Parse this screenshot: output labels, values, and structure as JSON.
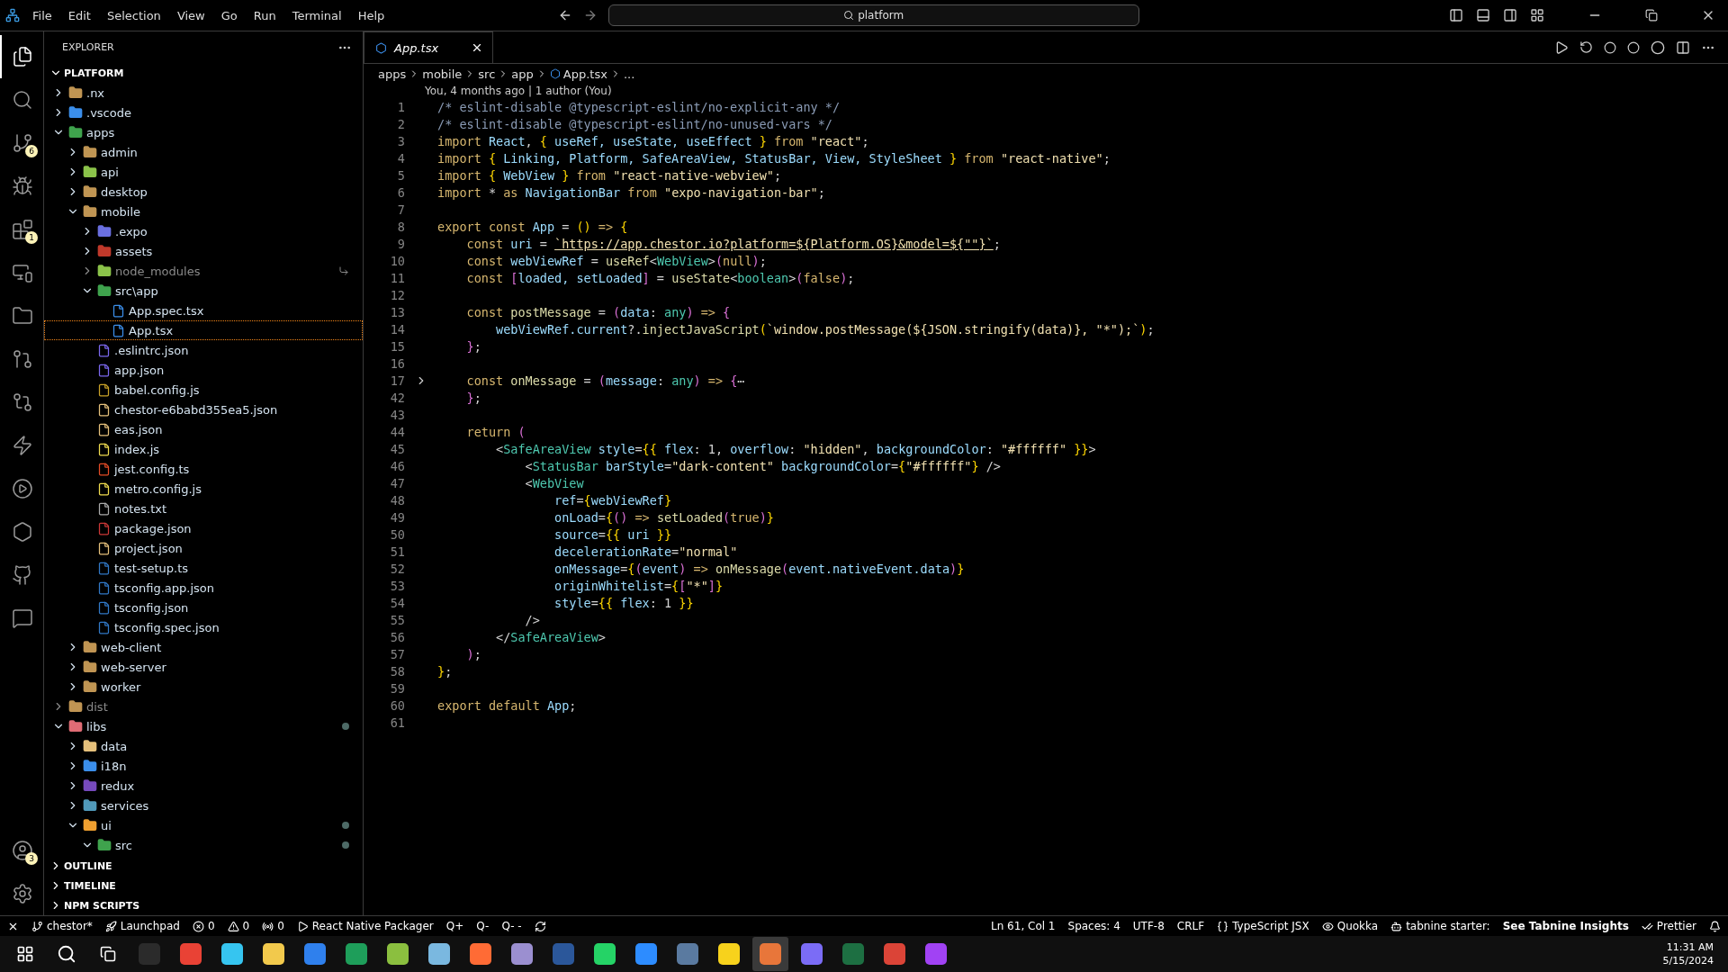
{
  "menu": [
    "File",
    "Edit",
    "Selection",
    "View",
    "Go",
    "Run",
    "Terminal",
    "Help"
  ],
  "command_center": {
    "value": "platform"
  },
  "activity_bar": [
    {
      "selected": true
    },
    {
      "selected": false
    },
    {
      "selected": false,
      "badge": "6"
    },
    {
      "selected": false
    },
    {
      "selected": false,
      "badge": "1"
    },
    {
      "selected": false
    },
    {
      "selected": false
    },
    {
      "selected": false
    },
    {
      "selected": false
    },
    {
      "selected": false
    },
    {
      "selected": false
    },
    {
      "selected": false
    },
    {
      "selected": false
    },
    {
      "selected": false
    }
  ],
  "account": {
    "badge": "3"
  },
  "explorer": {
    "title": "EXPLORER",
    "root": "PLATFORM",
    "root_expanded": true,
    "tree": [
      {
        "name": ".nx",
        "kind": "folder",
        "expanded": false,
        "color": "#c09553"
      },
      {
        "name": ".vscode",
        "kind": "folder",
        "expanded": false,
        "color": "#3b8eea"
      },
      {
        "name": "apps",
        "kind": "folder",
        "expanded": true,
        "color": "#3fa34d",
        "children": [
          {
            "name": "admin",
            "kind": "folder",
            "expanded": false,
            "color": "#c09553"
          },
          {
            "name": "api",
            "kind": "folder",
            "expanded": false,
            "color": "#8bc34a"
          },
          {
            "name": "desktop",
            "kind": "folder",
            "expanded": false,
            "color": "#c09553"
          },
          {
            "name": "mobile",
            "kind": "folder",
            "expanded": true,
            "color": "#c09553",
            "children": [
              {
                "name": ".expo",
                "kind": "folder",
                "expanded": false,
                "color": "#6a6fe0"
              },
              {
                "name": "assets",
                "kind": "folder",
                "expanded": false,
                "color": "#c0392b"
              },
              {
                "name": "node_modules",
                "kind": "folder",
                "expanded": false,
                "color": "#8bc34a",
                "ignored": true,
                "linked": true
              },
              {
                "name": "src\\app",
                "kind": "folder",
                "expanded": true,
                "color": "#3fa34d",
                "children": [
                  {
                    "name": "App.spec.tsx",
                    "kind": "file",
                    "color": "#3b8eea",
                    "selected": false
                  },
                  {
                    "name": "App.tsx",
                    "kind": "file",
                    "color": "#3b8eea",
                    "selected": true
                  }
                ]
              },
              {
                "name": ".eslintrc.json",
                "kind": "file",
                "color": "#7b68ee"
              },
              {
                "name": "app.json",
                "kind": "file",
                "color": "#7b68ee"
              },
              {
                "name": "babel.config.js",
                "kind": "file",
                "color": "#c9a227"
              },
              {
                "name": "chestor-e6babd355ea5.json",
                "kind": "file",
                "color": "#e5c07b"
              },
              {
                "name": "eas.json",
                "kind": "file",
                "color": "#e5c07b"
              },
              {
                "name": "index.js",
                "kind": "file",
                "color": "#f0db4f"
              },
              {
                "name": "jest.config.ts",
                "kind": "file",
                "color": "#e34c26"
              },
              {
                "name": "metro.config.js",
                "kind": "file",
                "color": "#f0db4f"
              },
              {
                "name": "notes.txt",
                "kind": "file",
                "color": "#aaaaaa"
              },
              {
                "name": "package.json",
                "kind": "file",
                "color": "#cb3837"
              },
              {
                "name": "project.json",
                "kind": "file",
                "color": "#e5c07b"
              },
              {
                "name": "test-setup.ts",
                "kind": "file",
                "color": "#3178c6"
              },
              {
                "name": "tsconfig.app.json",
                "kind": "file",
                "color": "#3178c6"
              },
              {
                "name": "tsconfig.json",
                "kind": "file",
                "color": "#3178c6"
              },
              {
                "name": "tsconfig.spec.json",
                "kind": "file",
                "color": "#3178c6"
              }
            ]
          },
          {
            "name": "web-client",
            "kind": "folder",
            "expanded": false,
            "color": "#c09553"
          },
          {
            "name": "web-server",
            "kind": "folder",
            "expanded": false,
            "color": "#c09553"
          },
          {
            "name": "worker",
            "kind": "folder",
            "expanded": false,
            "color": "#c09553"
          }
        ]
      },
      {
        "name": "dist",
        "kind": "folder",
        "expanded": false,
        "color": "#c09553",
        "ignored": true
      },
      {
        "name": "libs",
        "kind": "folder",
        "expanded": true,
        "color": "#e06c75",
        "modified": true,
        "children": [
          {
            "name": "data",
            "kind": "folder",
            "expanded": false,
            "color": "#e5c07b"
          },
          {
            "name": "i18n",
            "kind": "folder",
            "expanded": false,
            "color": "#3b8eea"
          },
          {
            "name": "redux",
            "kind": "folder",
            "expanded": false,
            "color": "#764abc"
          },
          {
            "name": "services",
            "kind": "folder",
            "expanded": false,
            "color": "#519aba"
          },
          {
            "name": "ui",
            "kind": "folder",
            "expanded": true,
            "color": "#f0a030",
            "modified": true,
            "children": [
              {
                "name": "src",
                "kind": "folder",
                "expanded": true,
                "color": "#3fa34d",
                "modified": true
              }
            ]
          }
        ]
      }
    ],
    "sections": [
      {
        "label": "OUTLINE",
        "expanded": false
      },
      {
        "label": "TIMELINE",
        "expanded": false
      },
      {
        "label": "NPM SCRIPTS",
        "expanded": false
      }
    ]
  },
  "tabs": [
    {
      "label": "App.tsx",
      "selected": true
    }
  ],
  "breadcrumbs": [
    "apps",
    "mobile",
    "src",
    "app",
    "App.tsx",
    "..."
  ],
  "blame": "You, 4 months ago | 1 author (You)",
  "code": [
    {
      "number": "1",
      "segments": [
        {
          "kind": "comment",
          "text": "/* eslint-disable @typescript-eslint/no-explicit-any */"
        }
      ]
    },
    {
      "number": "2",
      "segments": [
        {
          "kind": "comment",
          "text": "/* eslint-disable @typescript-eslint/no-unused-vars */"
        }
      ]
    },
    {
      "number": "3",
      "segments": [
        {
          "kind": "keyword",
          "text": "import "
        },
        {
          "kind": "ident",
          "text": "React"
        },
        {
          "kind": "punct",
          "text": ", "
        },
        {
          "kind": "brace",
          "text": "{"
        },
        {
          "kind": "ident",
          "text": " useRef, useState, useEffect "
        },
        {
          "kind": "brace",
          "text": "}"
        },
        {
          "kind": "keyword",
          "text": " from "
        },
        {
          "kind": "string",
          "text": "\"react\""
        },
        {
          "kind": "punct",
          "text": ";"
        }
      ]
    },
    {
      "number": "4",
      "segments": [
        {
          "kind": "keyword",
          "text": "import "
        },
        {
          "kind": "brace",
          "text": "{"
        },
        {
          "kind": "ident",
          "text": " Linking, Platform, SafeAreaView, StatusBar, View, StyleSheet "
        },
        {
          "kind": "brace",
          "text": "}"
        },
        {
          "kind": "keyword",
          "text": " from "
        },
        {
          "kind": "string",
          "text": "\"react-native\""
        },
        {
          "kind": "punct",
          "text": ";"
        }
      ]
    },
    {
      "number": "5",
      "segments": [
        {
          "kind": "keyword",
          "text": "import "
        },
        {
          "kind": "brace",
          "text": "{"
        },
        {
          "kind": "ident",
          "text": " WebView "
        },
        {
          "kind": "brace",
          "text": "}"
        },
        {
          "kind": "keyword",
          "text": " from "
        },
        {
          "kind": "string",
          "text": "\"react-native-webview\""
        },
        {
          "kind": "punct",
          "text": ";"
        }
      ]
    },
    {
      "number": "6",
      "segments": [
        {
          "kind": "keyword",
          "text": "import "
        },
        {
          "kind": "punct",
          "text": "* "
        },
        {
          "kind": "keyword",
          "text": "as "
        },
        {
          "kind": "ident",
          "text": "NavigationBar "
        },
        {
          "kind": "keyword",
          "text": "from "
        },
        {
          "kind": "string",
          "text": "\"expo-navigation-bar\""
        },
        {
          "kind": "punct",
          "text": ";"
        }
      ]
    },
    {
      "number": "7"
    },
    {
      "number": "8",
      "segments": [
        {
          "kind": "keyword",
          "text": "export const "
        },
        {
          "kind": "ident",
          "text": "App"
        },
        {
          "kind": "punct",
          "text": " = "
        },
        {
          "kind": "brace",
          "text": "()"
        },
        {
          "kind": "keyword",
          "text": " => "
        },
        {
          "kind": "brace",
          "text": "{"
        }
      ]
    },
    {
      "number": "9",
      "segments": [
        {
          "kind": "keyword",
          "text": "    const "
        },
        {
          "kind": "ident",
          "text": "uri"
        },
        {
          "kind": "punct",
          "text": " = "
        },
        {
          "kind": "url",
          "text": "`https://app.chestor.io?platform=${Platform.OS}&model=${\"\"}`"
        },
        {
          "kind": "punct",
          "text": ";"
        }
      ]
    },
    {
      "number": "10",
      "segments": [
        {
          "kind": "keyword",
          "text": "    const "
        },
        {
          "kind": "ident",
          "text": "webViewRef"
        },
        {
          "kind": "punct",
          "text": " = "
        },
        {
          "kind": "function",
          "text": "useRef"
        },
        {
          "kind": "punct",
          "text": "<"
        },
        {
          "kind": "type",
          "text": "WebView"
        },
        {
          "kind": "punct",
          "text": ">"
        },
        {
          "kind": "paren",
          "text": "("
        },
        {
          "kind": "keyword",
          "text": "null"
        },
        {
          "kind": "paren",
          "text": ")"
        },
        {
          "kind": "punct",
          "text": ";"
        }
      ]
    },
    {
      "number": "11",
      "segments": [
        {
          "kind": "keyword",
          "text": "    const "
        },
        {
          "kind": "paren",
          "text": "["
        },
        {
          "kind": "ident",
          "text": "loaded, setLoaded"
        },
        {
          "kind": "paren",
          "text": "]"
        },
        {
          "kind": "punct",
          "text": " = "
        },
        {
          "kind": "function",
          "text": "useState"
        },
        {
          "kind": "punct",
          "text": "<"
        },
        {
          "kind": "type",
          "text": "boolean"
        },
        {
          "kind": "punct",
          "text": ">"
        },
        {
          "kind": "paren",
          "text": "("
        },
        {
          "kind": "keyword",
          "text": "false"
        },
        {
          "kind": "paren",
          "text": ")"
        },
        {
          "kind": "punct",
          "text": ";"
        }
      ]
    },
    {
      "number": "12"
    },
    {
      "number": "13",
      "segments": [
        {
          "kind": "keyword",
          "text": "    const "
        },
        {
          "kind": "function",
          "text": "postMessage"
        },
        {
          "kind": "punct",
          "text": " = "
        },
        {
          "kind": "paren",
          "text": "("
        },
        {
          "kind": "ident",
          "text": "data"
        },
        {
          "kind": "punct",
          "text": ": "
        },
        {
          "kind": "type",
          "text": "any"
        },
        {
          "kind": "paren",
          "text": ")"
        },
        {
          "kind": "keyword",
          "text": " => "
        },
        {
          "kind": "paren",
          "text": "{"
        }
      ]
    },
    {
      "number": "14",
      "segments": [
        {
          "kind": "ident",
          "text": "        webViewRef.current"
        },
        {
          "kind": "punct",
          "text": "?."
        },
        {
          "kind": "function",
          "text": "injectJavaScript"
        },
        {
          "kind": "brace",
          "text": "("
        },
        {
          "kind": "string",
          "text": "`window.postMessage(${JSON.stringify(data)}, \"*\");`"
        },
        {
          "kind": "brace",
          "text": ")"
        },
        {
          "kind": "punct",
          "text": ";"
        }
      ]
    },
    {
      "number": "15",
      "segments": [
        {
          "kind": "paren",
          "text": "    }"
        },
        {
          "kind": "punct",
          "text": ";"
        }
      ]
    },
    {
      "number": "16"
    },
    {
      "number": "17",
      "folded": true,
      "segments": [
        {
          "kind": "keyword",
          "text": "    const "
        },
        {
          "kind": "function",
          "text": "onMessage"
        },
        {
          "kind": "punct",
          "text": " = "
        },
        {
          "kind": "paren",
          "text": "("
        },
        {
          "kind": "ident",
          "text": "message"
        },
        {
          "kind": "punct",
          "text": ": "
        },
        {
          "kind": "type",
          "text": "any"
        },
        {
          "kind": "paren",
          "text": ")"
        },
        {
          "kind": "keyword",
          "text": " => "
        },
        {
          "kind": "paren",
          "text": "{"
        },
        {
          "kind": "punct",
          "text": "⋯"
        }
      ]
    },
    {
      "number": "42",
      "segments": [
        {
          "kind": "paren",
          "text": "    }"
        },
        {
          "kind": "punct",
          "text": ";"
        }
      ]
    },
    {
      "number": "43"
    },
    {
      "number": "44",
      "segments": [
        {
          "kind": "keyword",
          "text": "    return "
        },
        {
          "kind": "paren",
          "text": "("
        }
      ]
    },
    {
      "number": "45",
      "segments": [
        {
          "kind": "punct",
          "text": "        <"
        },
        {
          "kind": "type",
          "text": "SafeAreaView "
        },
        {
          "kind": "ident",
          "text": "style"
        },
        {
          "kind": "punct",
          "text": "="
        },
        {
          "kind": "brace",
          "text": "{{"
        },
        {
          "kind": "ident",
          "text": " flex"
        },
        {
          "kind": "punct",
          "text": ": 1, "
        },
        {
          "kind": "ident",
          "text": "overflow"
        },
        {
          "kind": "punct",
          "text": ": "
        },
        {
          "kind": "string",
          "text": "\"hidden\""
        },
        {
          "kind": "punct",
          "text": ", "
        },
        {
          "kind": "ident",
          "text": "backgroundColor"
        },
        {
          "kind": "punct",
          "text": ": "
        },
        {
          "kind": "string",
          "text": "\"#ffffff\""
        },
        {
          "kind": "brace",
          "text": " }}"
        },
        {
          "kind": "punct",
          "text": ">"
        }
      ]
    },
    {
      "number": "46",
      "segments": [
        {
          "kind": "punct",
          "text": "            <"
        },
        {
          "kind": "type",
          "text": "StatusBar "
        },
        {
          "kind": "ident",
          "text": "barStyle"
        },
        {
          "kind": "punct",
          "text": "="
        },
        {
          "kind": "string",
          "text": "\"dark-content\""
        },
        {
          "kind": "ident",
          "text": " backgroundColor"
        },
        {
          "kind": "punct",
          "text": "="
        },
        {
          "kind": "brace",
          "text": "{"
        },
        {
          "kind": "string",
          "text": "\"#ffffff\""
        },
        {
          "kind": "brace",
          "text": "}"
        },
        {
          "kind": "punct",
          "text": " />"
        }
      ]
    },
    {
      "number": "47",
      "segments": [
        {
          "kind": "punct",
          "text": "            <"
        },
        {
          "kind": "type",
          "text": "WebView"
        }
      ]
    },
    {
      "number": "48",
      "segments": [
        {
          "kind": "ident",
          "text": "                ref"
        },
        {
          "kind": "punct",
          "text": "="
        },
        {
          "kind": "brace",
          "text": "{"
        },
        {
          "kind": "ident",
          "text": "webViewRef"
        },
        {
          "kind": "brace",
          "text": "}"
        }
      ]
    },
    {
      "number": "49",
      "segments": [
        {
          "kind": "ident",
          "text": "                onLoad"
        },
        {
          "kind": "punct",
          "text": "="
        },
        {
          "kind": "brace",
          "text": "{"
        },
        {
          "kind": "paren",
          "text": "()"
        },
        {
          "kind": "keyword",
          "text": " => "
        },
        {
          "kind": "function",
          "text": "setLoaded"
        },
        {
          "kind": "paren",
          "text": "("
        },
        {
          "kind": "keyword",
          "text": "true"
        },
        {
          "kind": "paren",
          "text": ")"
        },
        {
          "kind": "brace",
          "text": "}"
        }
      ]
    },
    {
      "number": "50",
      "segments": [
        {
          "kind": "ident",
          "text": "                source"
        },
        {
          "kind": "punct",
          "text": "="
        },
        {
          "kind": "brace",
          "text": "{{"
        },
        {
          "kind": "ident",
          "text": " uri "
        },
        {
          "kind": "brace",
          "text": "}}"
        }
      ]
    },
    {
      "number": "51",
      "segments": [
        {
          "kind": "ident",
          "text": "                decelerationRate"
        },
        {
          "kind": "punct",
          "text": "="
        },
        {
          "kind": "string",
          "text": "\"normal\""
        }
      ]
    },
    {
      "number": "52",
      "segments": [
        {
          "kind": "ident",
          "text": "                onMessage"
        },
        {
          "kind": "punct",
          "text": "="
        },
        {
          "kind": "brace",
          "text": "{"
        },
        {
          "kind": "paren",
          "text": "("
        },
        {
          "kind": "ident",
          "text": "event"
        },
        {
          "kind": "paren",
          "text": ")"
        },
        {
          "kind": "keyword",
          "text": " => "
        },
        {
          "kind": "function",
          "text": "onMessage"
        },
        {
          "kind": "paren",
          "text": "("
        },
        {
          "kind": "ident",
          "text": "event.nativeEvent.data"
        },
        {
          "kind": "paren",
          "text": ")"
        },
        {
          "kind": "brace",
          "text": "}"
        }
      ]
    },
    {
      "number": "53",
      "segments": [
        {
          "kind": "ident",
          "text": "                originWhitelist"
        },
        {
          "kind": "punct",
          "text": "="
        },
        {
          "kind": "brace",
          "text": "{"
        },
        {
          "kind": "paren",
          "text": "["
        },
        {
          "kind": "string",
          "text": "\"*\""
        },
        {
          "kind": "paren",
          "text": "]"
        },
        {
          "kind": "brace",
          "text": "}"
        }
      ]
    },
    {
      "number": "54",
      "segments": [
        {
          "kind": "ident",
          "text": "                style"
        },
        {
          "kind": "punct",
          "text": "="
        },
        {
          "kind": "brace",
          "text": "{{"
        },
        {
          "kind": "ident",
          "text": " flex"
        },
        {
          "kind": "punct",
          "text": ": 1 "
        },
        {
          "kind": "brace",
          "text": "}}"
        }
      ]
    },
    {
      "number": "55",
      "segments": [
        {
          "kind": "punct",
          "text": "            />"
        }
      ]
    },
    {
      "number": "56",
      "segments": [
        {
          "kind": "punct",
          "text": "        </"
        },
        {
          "kind": "type",
          "text": "SafeAreaView"
        },
        {
          "kind": "punct",
          "text": ">"
        }
      ]
    },
    {
      "number": "57",
      "segments": [
        {
          "kind": "paren",
          "text": "    )"
        },
        {
          "kind": "punct",
          "text": ";"
        }
      ]
    },
    {
      "number": "58",
      "segments": [
        {
          "kind": "brace",
          "text": "}"
        },
        {
          "kind": "punct",
          "text": ";"
        }
      ]
    },
    {
      "number": "59"
    },
    {
      "number": "60",
      "segments": [
        {
          "kind": "keyword",
          "text": "export default "
        },
        {
          "kind": "ident",
          "text": "App"
        },
        {
          "kind": "punct",
          "text": ";"
        }
      ]
    },
    {
      "number": "61"
    }
  ],
  "status_left": [
    {
      "text": "chestor*"
    },
    {
      "text": "Launchpad"
    },
    {
      "text": "0"
    },
    {
      "text": "0"
    },
    {
      "text": "0"
    },
    {
      "text": "React Native Packager"
    },
    {
      "text": "Q+"
    },
    {
      "text": "Q-"
    },
    {
      "text": "Q- -"
    }
  ],
  "status_right": [
    {
      "text": "Ln 61, Col 1",
      "bold": false
    },
    {
      "text": "Spaces: 4",
      "bold": false
    },
    {
      "text": "UTF-8",
      "bold": false
    },
    {
      "text": "CRLF",
      "bold": false
    },
    {
      "text": "TypeScript JSX",
      "bold": false
    },
    {
      "text": "Quokka",
      "bold": false
    },
    {
      "text": "tabnine starter:",
      "bold": false
    },
    {
      "text": "See Tabnine Insights",
      "bold": true
    },
    {
      "text": "Prettier",
      "bold": false
    }
  ],
  "taskbar": {
    "apps": [
      {
        "color": "#2b2b2b",
        "selected": false
      },
      {
        "color": "#e94235",
        "selected": false
      },
      {
        "color": "#36c5f0",
        "selected": false
      },
      {
        "color": "#f2c94c",
        "selected": false
      },
      {
        "color": "#2f80ed",
        "selected": false
      },
      {
        "color": "#1e9e5a",
        "selected": false
      },
      {
        "color": "#8bbf3f",
        "selected": false
      },
      {
        "color": "#7ab8e0",
        "selected": false
      },
      {
        "color": "#ff6b35",
        "selected": false
      },
      {
        "color": "#9b8fd0",
        "selected": false
      },
      {
        "color": "#2b579a",
        "selected": false
      },
      {
        "color": "#25d366",
        "selected": false
      },
      {
        "color": "#2d8cff",
        "selected": false
      },
      {
        "color": "#5a7aa0",
        "selected": false
      },
      {
        "color": "#f7d21c",
        "selected": false
      },
      {
        "color": "#e8763a",
        "selected": true
      },
      {
        "color": "#7b6cf6",
        "selected": false
      },
      {
        "color": "#1d6f42",
        "selected": false
      },
      {
        "color": "#db4437",
        "selected": false
      },
      {
        "color": "#a142f4",
        "selected": false
      }
    ],
    "time": "11:31 AM",
    "date": "5/15/2024"
  }
}
